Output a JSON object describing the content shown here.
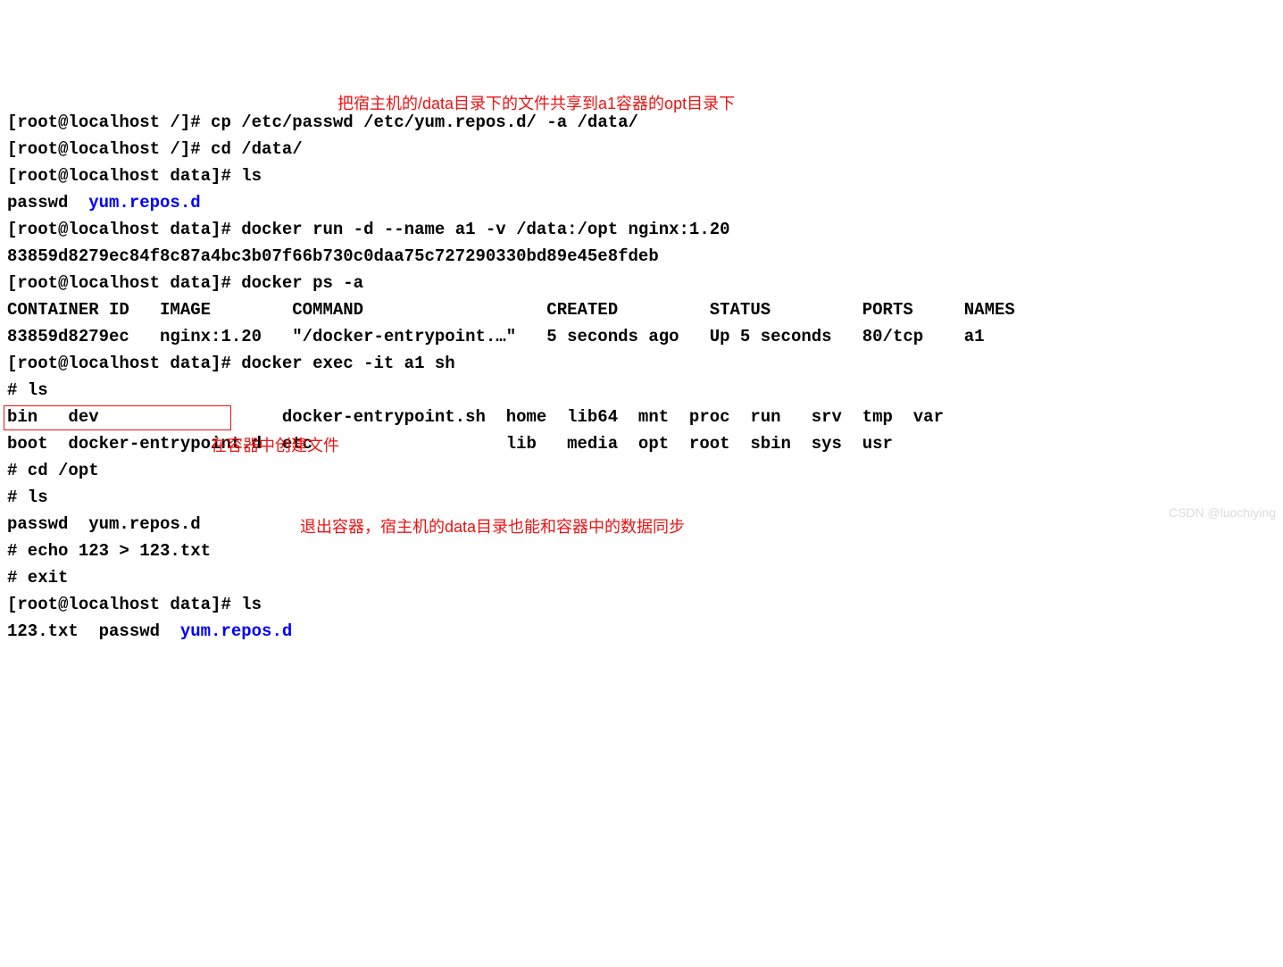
{
  "lines": {
    "l1_prompt": "[root@localhost /]# ",
    "l1_cmd": "cp /etc/passwd /etc/yum.repos.d/ -a /data/",
    "l2_prompt": "[root@localhost /]# ",
    "l2_cmd": "cd /data/",
    "l3_prompt": "[root@localhost data]# ",
    "l3_cmd": "ls",
    "l4_passwd": "passwd  ",
    "l4_dir": "yum.repos.d",
    "l5_prompt": "[root@localhost data]# ",
    "l5_cmd": "docker run -d --name a1 -v /data:/opt nginx:1.20",
    "l6": "83859d8279ec84f8c87a4bc3b07f66b730c0daa75c727290330bd89e45e8fdeb",
    "l7_prompt": "[root@localhost data]# ",
    "l7_cmd": "docker ps -a",
    "l8_hdr": "CONTAINER ID   IMAGE        COMMAND                  CREATED         STATUS         PORTS     NAMES",
    "l9_row": "83859d8279ec   nginx:1.20   \"/docker-entrypoint.…\"   5 seconds ago   Up 5 seconds   80/tcp    a1",
    "l10_prompt": "[root@localhost data]# ",
    "l10_cmd": "docker exec -it a1 sh",
    "l11": "# ls",
    "l12": "bin   dev                  docker-entrypoint.sh  home  lib64  mnt  proc  run   srv  tmp  var",
    "l13": "boot  docker-entrypoint.d  etc                   lib   media  opt  root  sbin  sys  usr",
    "l14": "# cd /opt",
    "l15": "# ls",
    "l16": "passwd  yum.repos.d",
    "l17": "# echo 123 > 123.txt",
    "l18": "# exit",
    "l19_prompt": "[root@localhost data]# ",
    "l19_cmd": "ls",
    "l20_a": "123.txt  passwd  ",
    "l20_dir": "yum.repos.d"
  },
  "annotations": {
    "ann1": "把宿主机的/data目录下的文件共享到a1容器的opt目录下",
    "ann2": "在容器中创建文件",
    "ann3": "退出容器，宿主机的data目录也能和容器中的数据同步"
  },
  "watermark": "CSDN @luochiying"
}
